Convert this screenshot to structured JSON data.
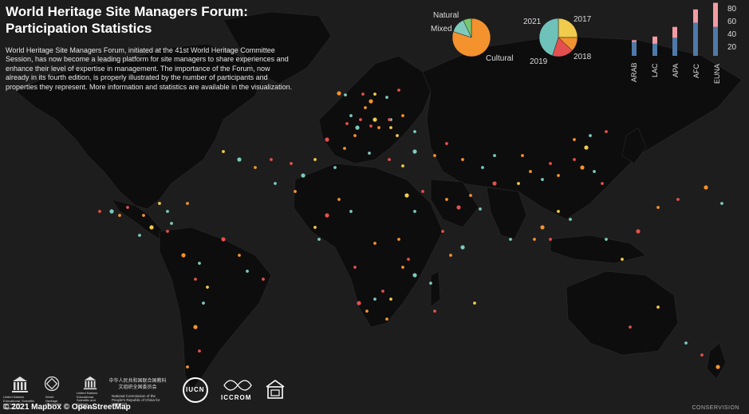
{
  "title": "World Heritage Site Managers Forum: Participation Statistics",
  "description": "World Heritage Site Managers Forum, initiated at the 41st World Heritage Committee Session, has now become a leading platform for site managers to share experiences and enhance their level of expertise in management. The importance of the Forum, now already in its fourth edition, is properly illustrated by the number of participants and properties they represent. More information and statistics are available in the visualization.",
  "colors": {
    "cultural": "#f4922e",
    "natural": "#7fc9bd",
    "mixed": "#7cc56f",
    "y2017": "#f1cc4c",
    "y2018": "#f0922e",
    "y2019": "#e4504f",
    "y2021": "#6fc2b9",
    "bar_blue": "#4f79a8",
    "bar_pink": "#f39ba3"
  },
  "type_pie": {
    "labels": {
      "natural": "Natural",
      "mixed": "Mixed",
      "cultural": "Cultural"
    },
    "values": {
      "cultural": 80,
      "natural": 13,
      "mixed": 7
    }
  },
  "year_pie": {
    "labels": {
      "y2021": "2021",
      "y2017": "2017",
      "y2018": "2018",
      "y2019": "2019"
    },
    "values": {
      "y2021": 45,
      "y2017": 25,
      "y2018": 12,
      "y2019": 18
    }
  },
  "chart_data": {
    "type": "bar",
    "categories": [
      "ARAB",
      "LAC",
      "APA",
      "AFC",
      "EUNA"
    ],
    "series": [
      {
        "values": [
          23,
          20,
          30,
          55,
          48
        ]
      },
      {
        "values": [
          3,
          12,
          18,
          22,
          40
        ]
      }
    ],
    "yticks": [
      "80",
      "60",
      "40",
      "20"
    ],
    "ylim": [
      0,
      90
    ]
  },
  "logos": {
    "unesco": "United Nations Educational, Scientific and Cultural Organization",
    "whc": "World Heritage Convention",
    "unesco2": "United Nations Educational, Scientific and Cultural Organization",
    "china_cn": "中华人民共和国联合国教科文组织全国委员会",
    "china_en": "National Commission of the People's Republic of China for UNESCO",
    "iucn": "IUCN",
    "iccrom": "ICCROM"
  },
  "attribution": "© 2021 Mapbox © OpenStreetMap",
  "brand": "CONSERVISION"
}
